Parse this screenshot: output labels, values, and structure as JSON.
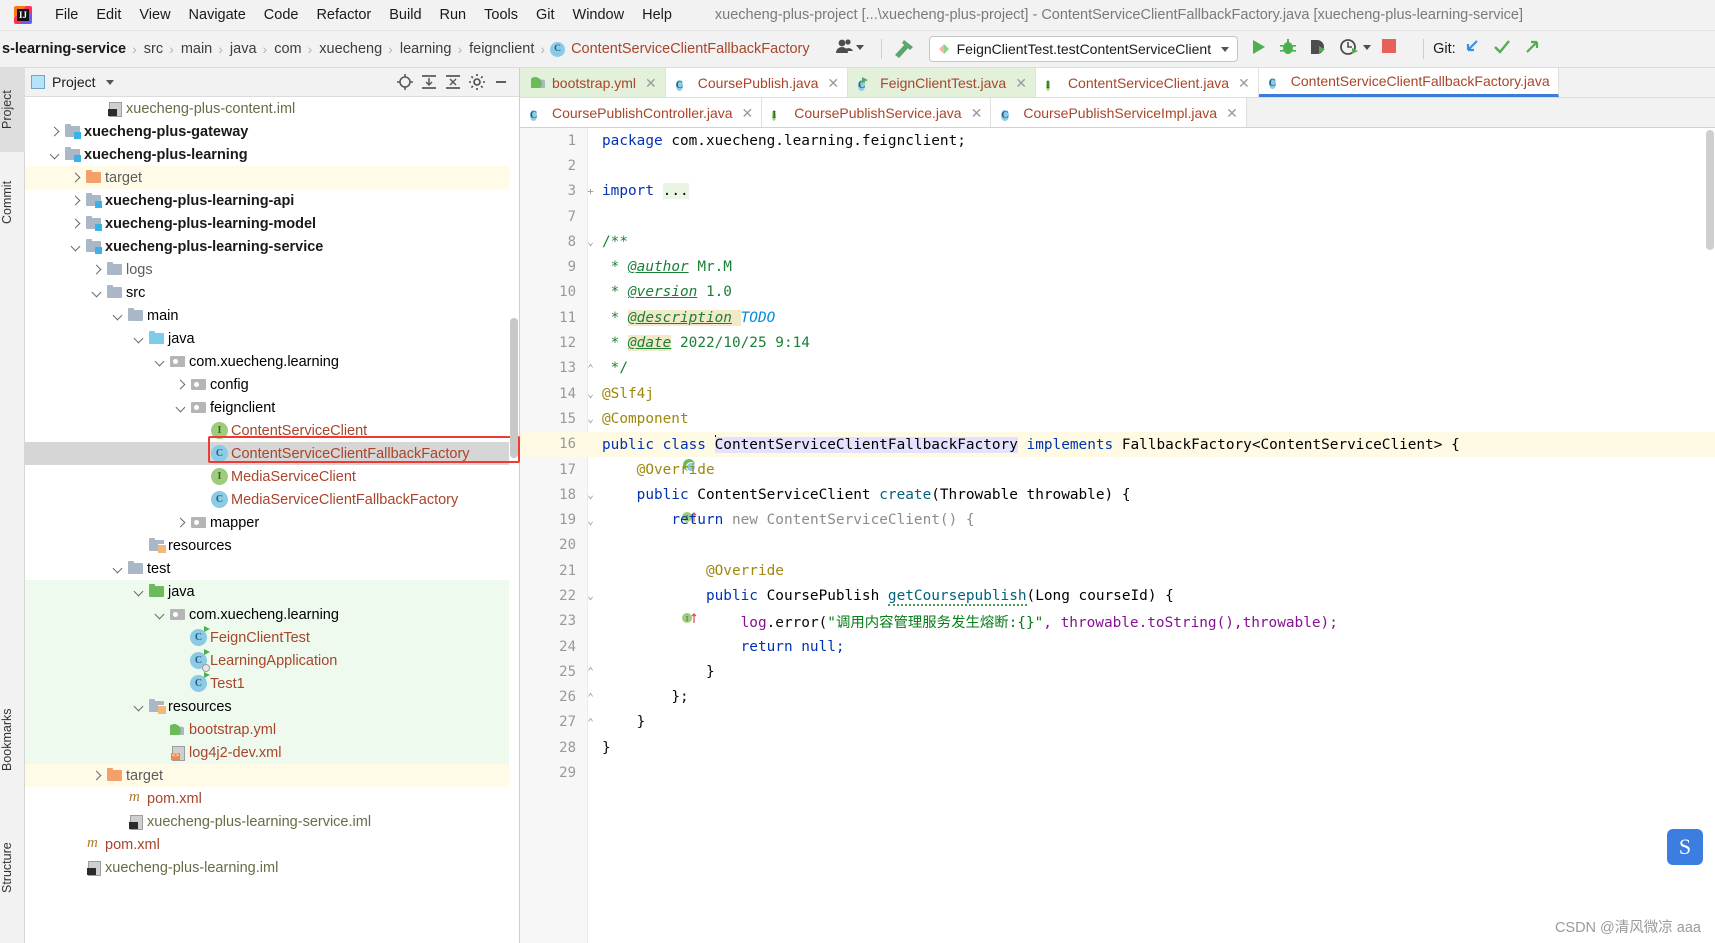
{
  "window": {
    "title": "xuecheng-plus-project [...\\xuecheng-plus-project] - ContentServiceClientFallbackFactory.java [xuecheng-plus-learning-service]",
    "logo_glyph": "IJ"
  },
  "menubar": {
    "items": [
      "File",
      "Edit",
      "View",
      "Navigate",
      "Code",
      "Refactor",
      "Build",
      "Run",
      "Tools",
      "Git",
      "Window",
      "Help"
    ]
  },
  "breadcrumb": {
    "items": [
      {
        "label": "s-learning-service",
        "type": "module"
      },
      {
        "label": "src",
        "type": "dir"
      },
      {
        "label": "main",
        "type": "dir"
      },
      {
        "label": "java",
        "type": "dir"
      },
      {
        "label": "com",
        "type": "pkg"
      },
      {
        "label": "xuecheng",
        "type": "pkg"
      },
      {
        "label": "learning",
        "type": "pkg"
      },
      {
        "label": "feignclient",
        "type": "pkg"
      },
      {
        "label": "ContentServiceClientFallbackFactory",
        "type": "class"
      }
    ],
    "separator": "›"
  },
  "toolbar": {
    "run_config": "FeignClientTest.testContentServiceClient",
    "git_label": "Git:",
    "icons": [
      "users-icon",
      "build-hammer-icon",
      "run-icon",
      "debug-icon",
      "run-with-coverage-icon",
      "profile-icon",
      "stop-icon",
      "git-update-icon",
      "git-commit-icon",
      "git-push-icon"
    ]
  },
  "toolstrip": {
    "left_tabs": [
      {
        "label": "Project",
        "icon": "project-icon",
        "active": true
      },
      {
        "label": "Commit",
        "icon": "commit-icon",
        "active": false
      },
      {
        "label": "Bookmarks",
        "icon": "bookmark-icon",
        "active": false
      },
      {
        "label": "Structure",
        "icon": "structure-icon",
        "active": false
      }
    ]
  },
  "project_panel": {
    "title": "Project",
    "header_icons": [
      "locate-icon",
      "expand-all-icon",
      "collapse-all-icon",
      "gear-icon",
      "hide-icon"
    ],
    "tree": [
      {
        "indent": 3,
        "arrow": "none",
        "icon": "iml-file",
        "label": "xuecheng-plus-content.iml",
        "style": "iml",
        "row": "plain"
      },
      {
        "indent": 1,
        "arrow": "right",
        "icon": "module-folder",
        "label": "xuecheng-plus-gateway",
        "style": "bold",
        "row": "plain"
      },
      {
        "indent": 1,
        "arrow": "down",
        "icon": "module-folder",
        "label": "xuecheng-plus-learning",
        "style": "bold",
        "row": "plain"
      },
      {
        "indent": 2,
        "arrow": "right",
        "icon": "folder-orange",
        "label": "target",
        "style": "dim",
        "row": "yellow"
      },
      {
        "indent": 2,
        "arrow": "right",
        "icon": "module-folder",
        "label": "xuecheng-plus-learning-api",
        "style": "bold",
        "row": "plain"
      },
      {
        "indent": 2,
        "arrow": "right",
        "icon": "module-folder",
        "label": "xuecheng-plus-learning-model",
        "style": "bold",
        "row": "plain"
      },
      {
        "indent": 2,
        "arrow": "down",
        "icon": "module-folder",
        "label": "xuecheng-plus-learning-service",
        "style": "bold",
        "row": "plain"
      },
      {
        "indent": 3,
        "arrow": "right",
        "icon": "folder",
        "label": "logs",
        "style": "dim",
        "row": "plain"
      },
      {
        "indent": 3,
        "arrow": "down",
        "icon": "folder",
        "label": "src",
        "style": "normal",
        "row": "plain"
      },
      {
        "indent": 4,
        "arrow": "down",
        "icon": "folder",
        "label": "main",
        "style": "normal",
        "row": "plain"
      },
      {
        "indent": 5,
        "arrow": "down",
        "icon": "folder-blue",
        "label": "java",
        "style": "normal",
        "row": "plain"
      },
      {
        "indent": 6,
        "arrow": "down",
        "icon": "package",
        "label": "com.xuecheng.learning",
        "style": "normal",
        "row": "plain"
      },
      {
        "indent": 7,
        "arrow": "right",
        "icon": "package",
        "label": "config",
        "style": "normal",
        "row": "plain"
      },
      {
        "indent": 7,
        "arrow": "down",
        "icon": "package",
        "label": "feignclient",
        "style": "normal",
        "row": "plain"
      },
      {
        "indent": 8,
        "arrow": "none",
        "icon": "interface",
        "label": "ContentServiceClient",
        "style": "file",
        "row": "plain"
      },
      {
        "indent": 8,
        "arrow": "none",
        "icon": "class",
        "label": "ContentServiceClientFallbackFactory",
        "style": "file",
        "row": "selected"
      },
      {
        "indent": 8,
        "arrow": "none",
        "icon": "interface",
        "label": "MediaServiceClient",
        "style": "file",
        "row": "plain"
      },
      {
        "indent": 8,
        "arrow": "none",
        "icon": "class",
        "label": "MediaServiceClientFallbackFactory",
        "style": "file",
        "row": "plain"
      },
      {
        "indent": 7,
        "arrow": "right",
        "icon": "package",
        "label": "mapper",
        "style": "normal",
        "row": "plain"
      },
      {
        "indent": 5,
        "arrow": "none",
        "icon": "resources-folder",
        "label": "resources",
        "style": "normal",
        "row": "plain"
      },
      {
        "indent": 4,
        "arrow": "down",
        "icon": "folder",
        "label": "test",
        "style": "normal",
        "row": "plain"
      },
      {
        "indent": 5,
        "arrow": "down",
        "icon": "folder-green",
        "label": "java",
        "style": "normal",
        "row": "green"
      },
      {
        "indent": 6,
        "arrow": "down",
        "icon": "package",
        "label": "com.xuecheng.learning",
        "style": "normal",
        "row": "green"
      },
      {
        "indent": 7,
        "arrow": "none",
        "icon": "class-test",
        "label": "FeignClientTest",
        "style": "file",
        "row": "green"
      },
      {
        "indent": 7,
        "arrow": "none",
        "icon": "class-app",
        "label": "LearningApplication",
        "style": "file",
        "row": "green"
      },
      {
        "indent": 7,
        "arrow": "none",
        "icon": "class-test",
        "label": "Test1",
        "style": "file",
        "row": "green"
      },
      {
        "indent": 5,
        "arrow": "down",
        "icon": "test-resources-folder",
        "label": "resources",
        "style": "normal",
        "row": "green"
      },
      {
        "indent": 6,
        "arrow": "none",
        "icon": "yaml-file",
        "label": "bootstrap.yml",
        "style": "file",
        "row": "green"
      },
      {
        "indent": 6,
        "arrow": "none",
        "icon": "xml-file",
        "label": "log4j2-dev.xml",
        "style": "file",
        "row": "green"
      },
      {
        "indent": 3,
        "arrow": "right",
        "icon": "folder-orange",
        "label": "target",
        "style": "dim",
        "row": "yellow"
      },
      {
        "indent": 4,
        "arrow": "none",
        "icon": "maven-file",
        "label": "pom.xml",
        "style": "file",
        "row": "plain"
      },
      {
        "indent": 4,
        "arrow": "none",
        "icon": "iml-file",
        "label": "xuecheng-plus-learning-service.iml",
        "style": "iml",
        "row": "plain"
      },
      {
        "indent": 2,
        "arrow": "none",
        "icon": "maven-file",
        "label": "pom.xml",
        "style": "file",
        "row": "plain"
      },
      {
        "indent": 2,
        "arrow": "none",
        "icon": "iml-file",
        "label": "xuecheng-plus-learning.iml",
        "style": "iml",
        "row": "plain"
      }
    ]
  },
  "editor": {
    "tabs_row1": [
      {
        "label": "bootstrap.yml",
        "icon": "yaml-file",
        "state": "green",
        "closable": true
      },
      {
        "label": "CoursePublish.java",
        "icon": "class",
        "state": "white",
        "closable": true
      },
      {
        "label": "FeignClientTest.java",
        "icon": "class-test",
        "state": "green",
        "closable": true
      },
      {
        "label": "ContentServiceClient.java",
        "icon": "interface",
        "state": "white",
        "closable": true
      },
      {
        "label": "ContentServiceClientFallbackFactory.java",
        "icon": "class",
        "state": "active",
        "closable": false
      }
    ],
    "tabs_row2": [
      {
        "label": "CoursePublishController.java",
        "icon": "class",
        "state": "white",
        "closable": true
      },
      {
        "label": "CoursePublishService.java",
        "icon": "interface",
        "state": "white",
        "closable": true
      },
      {
        "label": "CoursePublishServiceImpl.java",
        "icon": "class",
        "state": "white",
        "closable": true
      }
    ],
    "lines": [
      {
        "n": "1",
        "fold": "",
        "gmark": "",
        "current": false
      },
      {
        "n": "2",
        "fold": "",
        "gmark": "",
        "current": false
      },
      {
        "n": "3",
        "fold": "+",
        "gmark": "",
        "current": false
      },
      {
        "n": "7",
        "fold": "",
        "gmark": "",
        "current": false
      },
      {
        "n": "8",
        "fold": "v",
        "gmark": "",
        "current": false
      },
      {
        "n": "9",
        "fold": "",
        "gmark": "",
        "current": false
      },
      {
        "n": "10",
        "fold": "",
        "gmark": "",
        "current": false
      },
      {
        "n": "11",
        "fold": "",
        "gmark": "",
        "current": false
      },
      {
        "n": "12",
        "fold": "",
        "gmark": "",
        "current": false
      },
      {
        "n": "13",
        "fold": "^",
        "gmark": "",
        "current": false
      },
      {
        "n": "14",
        "fold": "v",
        "gmark": "",
        "current": false
      },
      {
        "n": "15",
        "fold": "v",
        "gmark": "",
        "current": false
      },
      {
        "n": "16",
        "fold": "",
        "gmark": "bean",
        "current": true
      },
      {
        "n": "17",
        "fold": "",
        "gmark": "",
        "current": false
      },
      {
        "n": "18",
        "fold": "v",
        "gmark": "impl-up",
        "current": false
      },
      {
        "n": "19",
        "fold": "v",
        "gmark": "",
        "current": false
      },
      {
        "n": "20",
        "fold": "",
        "gmark": "",
        "current": false
      },
      {
        "n": "21",
        "fold": "",
        "gmark": "",
        "current": false
      },
      {
        "n": "22",
        "fold": "v",
        "gmark": "impl-up",
        "current": false
      },
      {
        "n": "23",
        "fold": "",
        "gmark": "",
        "current": false
      },
      {
        "n": "24",
        "fold": "",
        "gmark": "",
        "current": false
      },
      {
        "n": "25",
        "fold": "^",
        "gmark": "",
        "current": false
      },
      {
        "n": "26",
        "fold": "^",
        "gmark": "",
        "current": false
      },
      {
        "n": "27",
        "fold": "^",
        "gmark": "",
        "current": false
      },
      {
        "n": "28",
        "fold": "",
        "gmark": "",
        "current": false
      },
      {
        "n": "29",
        "fold": "",
        "gmark": "",
        "current": false
      }
    ],
    "code": {
      "l1_kw": "package",
      "l1_rest": " com.xuecheng.learning.feignclient;",
      "l3_kw": "import",
      "l3_dots": "...",
      "l8": "/**",
      "l9_star": " * ",
      "l9_tag": "@author",
      "l9_val": " Mr.M",
      "l10_tag": "@version",
      "l10_val": " 1.0",
      "l11_tag": "@description",
      "l11_val": "TODO",
      "l12_tag": "@date",
      "l12_val": " 2022/10/25 9:14",
      "l13": " */",
      "l14": "@Slf4j",
      "l15": "@Component",
      "l16_a": "public class ",
      "l16_name": "ContentServiceClientFallbackFactory",
      "l16_b": " implements ",
      "l16_c": "FallbackFactory<ContentServiceClient> {",
      "l17": "@Override",
      "l18_kw": "public",
      "l18_type": " ContentServiceClient ",
      "l18_mth": "create",
      "l18_args": "(Throwable throwable) {",
      "l19_kw": "return",
      "l19_new": " new ",
      "l19_rest": "ContentServiceClient() {",
      "l21": "@Override",
      "l22_kw": "public",
      "l22_type": " CoursePublish ",
      "l22_mth": "getCoursepublish",
      "l22_args": "(Long courseId) {",
      "l23_log": "log",
      "l23_dot": ".error(",
      "l23_str": "\"调用内容管理服务发生熔断:{}\"",
      "l23_rest": ", throwable.toString(),throwable);",
      "l24_kw": "return",
      "l24_val": " null;",
      "l25": "}",
      "l26": "};",
      "l27": "}",
      "l28": "}"
    }
  },
  "watermark": {
    "ime_glyph": "S",
    "credit": "CSDN @清风微凉 aaa"
  },
  "colors": {
    "accent_blue": "#3b7dd8",
    "string_green": "#067d17",
    "keyword_blue": "#0033b3",
    "annotation": "#9e880d",
    "class_orange": "#a8452a",
    "highlight_red": "#ef3b34",
    "tab_green": "#e3f0da",
    "row_green": "#effaef",
    "row_yellow": "#fffbe6"
  }
}
